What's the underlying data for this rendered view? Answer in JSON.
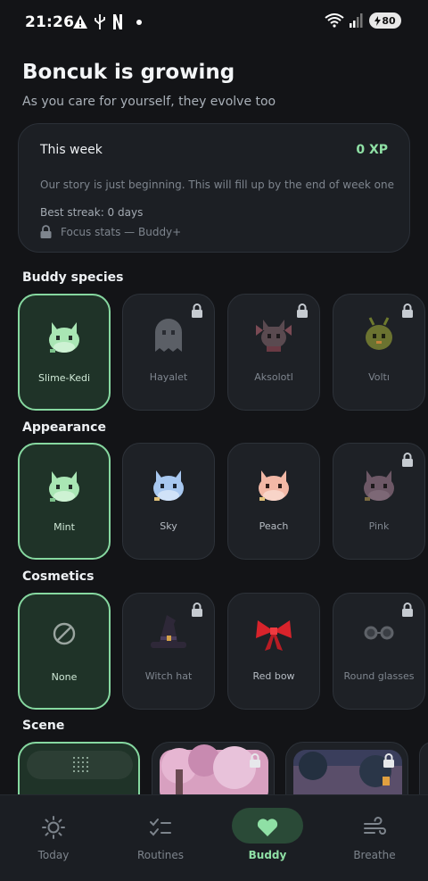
{
  "status": {
    "time": "21:26",
    "battery": "80",
    "signal_badge": "6"
  },
  "header": {
    "title": "Boncuk is growing",
    "subtitle": "As you care for yourself, they evolve too"
  },
  "week": {
    "title": "This week",
    "xp": "0 XP",
    "story": "Our story is just beginning. This will fill up by the end of week one",
    "streak": "Best streak: 0 days",
    "focus": "Focus stats — Buddy+"
  },
  "sections": {
    "species": "Buddy species",
    "appearance": "Appearance",
    "cosmetics": "Cosmetics",
    "scene": "Scene"
  },
  "species": [
    {
      "label": "Slime-Kedi",
      "selected": true,
      "locked": false
    },
    {
      "label": "Hayalet",
      "selected": false,
      "locked": true
    },
    {
      "label": "Aksolotl",
      "selected": false,
      "locked": true
    },
    {
      "label": "Voltı",
      "selected": false,
      "locked": true
    }
  ],
  "appearance": [
    {
      "label": "Mint",
      "selected": true,
      "locked": false,
      "color": "#a9e6b4"
    },
    {
      "label": "Sky",
      "selected": false,
      "locked": false,
      "color": "#a8c8f0"
    },
    {
      "label": "Peach",
      "selected": false,
      "locked": false,
      "color": "#f2b8a6"
    },
    {
      "label": "Pink",
      "selected": false,
      "locked": true,
      "color": "#6d5866"
    }
  ],
  "cosmetics": [
    {
      "label": "None",
      "selected": true,
      "locked": false
    },
    {
      "label": "Witch hat",
      "selected": false,
      "locked": true
    },
    {
      "label": "Red bow",
      "selected": false,
      "locked": false
    },
    {
      "label": "Round glasses",
      "selected": false,
      "locked": true
    }
  ],
  "nav": {
    "today": "Today",
    "routines": "Routines",
    "buddy": "Buddy",
    "breathe": "Breathe",
    "active": "Buddy"
  },
  "colors": {
    "accent": "#86d8a0",
    "background": "#131417",
    "card": "#1e2126"
  }
}
